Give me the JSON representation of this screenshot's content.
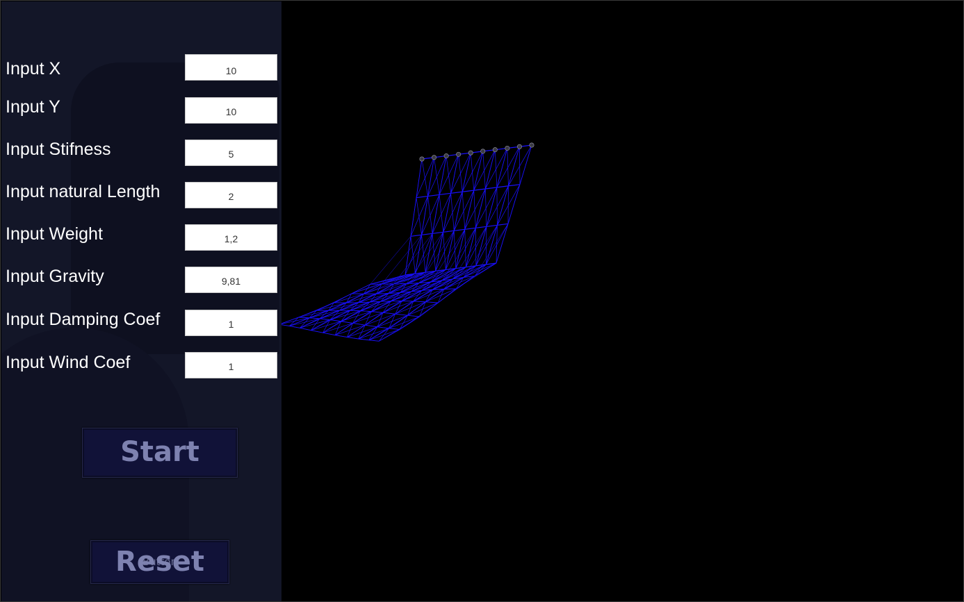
{
  "inputs": [
    {
      "label": "Input X",
      "value": "10"
    },
    {
      "label": "Input Y",
      "value": "10"
    },
    {
      "label": "Input Stifness",
      "value": "5"
    },
    {
      "label": "Input natural Length",
      "value": "2"
    },
    {
      "label": "Input Weight",
      "value": "1,2"
    },
    {
      "label": "Input Gravity",
      "value": "9,81"
    },
    {
      "label": "Input Damping Coef",
      "value": "1"
    },
    {
      "label": "Input Wind Coef",
      "value": "1"
    }
  ],
  "buttons": {
    "start_label": "Start",
    "reset_label": "Reset",
    "reset_underlay": "Button"
  },
  "colors": {
    "panel": "#131628",
    "button_bg": "#111238",
    "button_text": "#7e82b0",
    "mesh": "#1a10ff",
    "viewport_bg": "#000000"
  }
}
